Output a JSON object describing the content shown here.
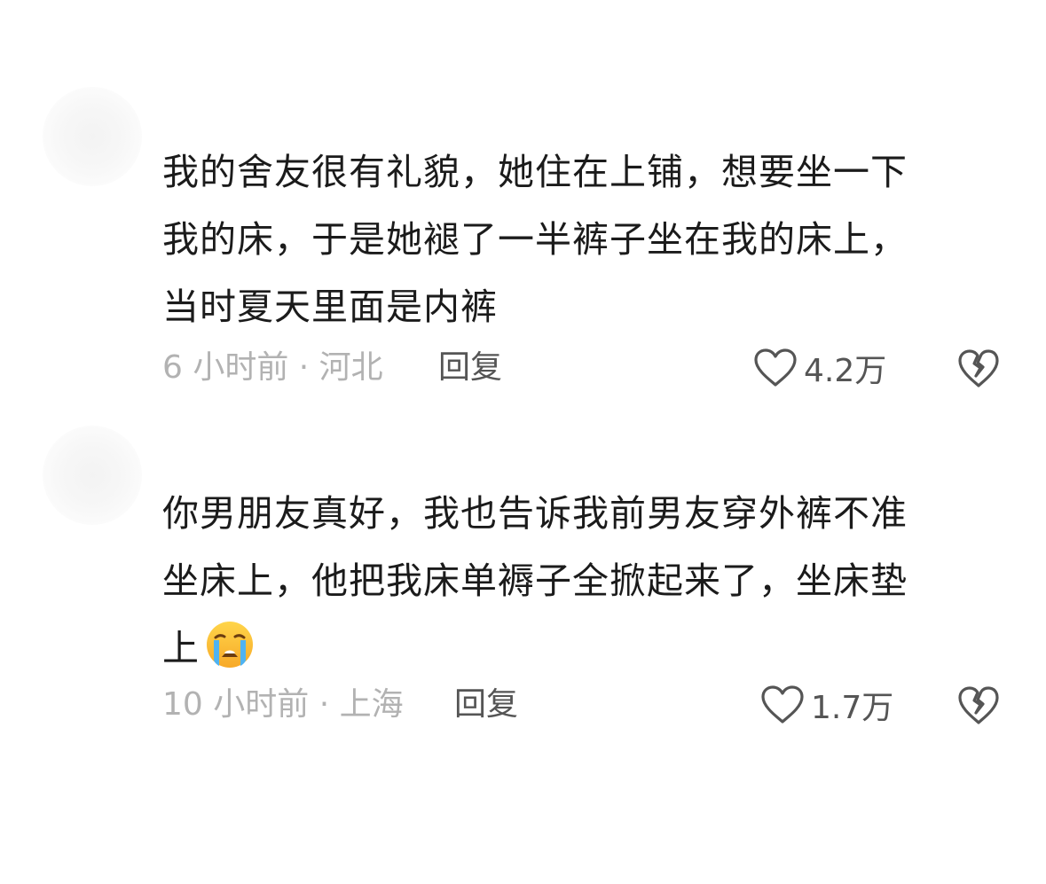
{
  "comments": [
    {
      "text": "我的舍友很有礼貌，她住在上铺，想要坐一下\n我的床，于是她褪了一半裤子坐在我的床上，\n当时夏天里面是内裤",
      "meta": "6 小时前 · 河北",
      "reply_label": "回复",
      "like_count": "4.2万",
      "has_emoji": false
    },
    {
      "text": "你男朋友真好，我也告诉我前男友穿外裤不准\n坐床上，他把我床单褥子全掀起来了，坐床垫\n上",
      "emoji": "loudly-crying-face",
      "meta": "10 小时前 · 上海",
      "reply_label": "回复",
      "like_count": "1.7万",
      "has_emoji": true
    }
  ]
}
